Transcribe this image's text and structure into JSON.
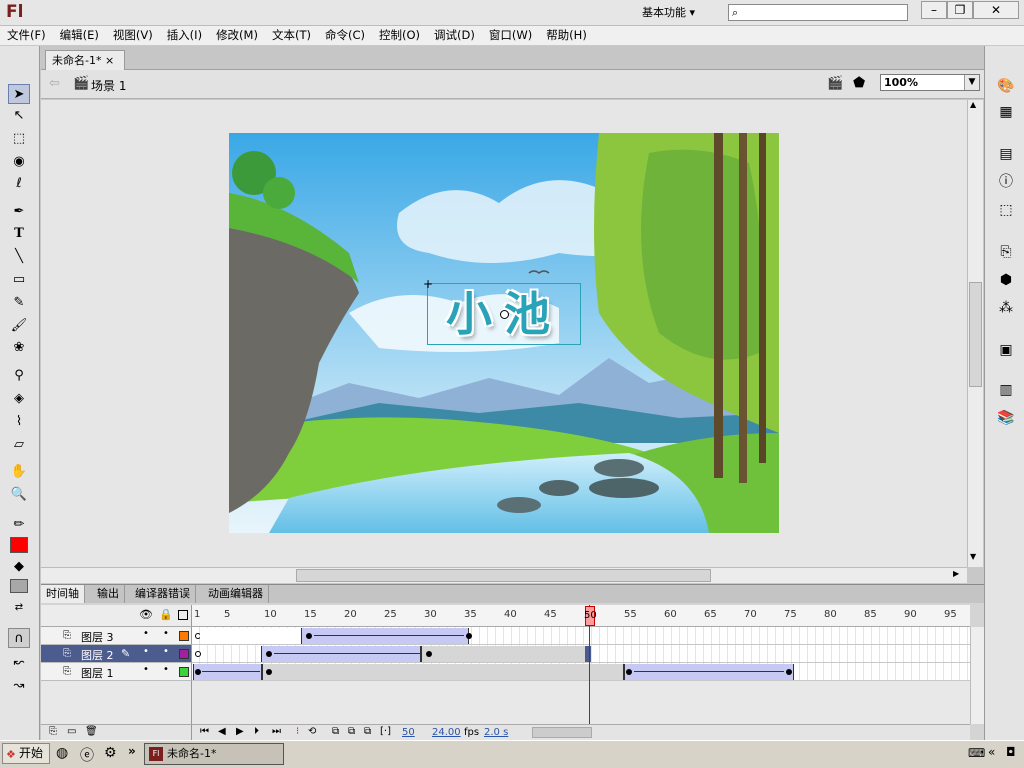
{
  "app": {
    "logo": "Fl",
    "workspace": "基本功能",
    "search_placeholder": ""
  },
  "menu": [
    "文件(F)",
    "编辑(E)",
    "视图(V)",
    "插入(I)",
    "修改(M)",
    "文本(T)",
    "命令(C)",
    "控制(O)",
    "调试(D)",
    "窗口(W)",
    "帮助(H)"
  ],
  "document": {
    "tab_label": "未命名-1*",
    "scene_label": "场景 1",
    "zoom": "100%"
  },
  "stage": {
    "title_text": "小池",
    "bg_sky": "#4fb3e8",
    "accent": "#29a3b8"
  },
  "timeline": {
    "tabs": [
      "时间轴",
      "输出",
      "编译器错误",
      "动画编辑器"
    ],
    "frame_numbers": [
      "1",
      "5",
      "10",
      "15",
      "20",
      "25",
      "30",
      "35",
      "40",
      "45",
      "50",
      "55",
      "60",
      "65",
      "70",
      "75",
      "80",
      "85",
      "90",
      "95"
    ],
    "current_frame": 50,
    "layers": [
      {
        "name": "图层 3",
        "color": "#ff7a00",
        "selected": false
      },
      {
        "name": "图层 2",
        "color": "#a020a0",
        "selected": true
      },
      {
        "name": "图层 1",
        "color": "#3bd23b",
        "selected": false
      }
    ],
    "status": {
      "frame": "50",
      "fps": "24.00",
      "fps_label": "fps",
      "time": "2.0 s"
    }
  },
  "taskbar": {
    "start_label": "开始",
    "doc_label": "未命名-1*"
  },
  "colors": {
    "stroke": "#000000",
    "fill": "#ff0000"
  }
}
